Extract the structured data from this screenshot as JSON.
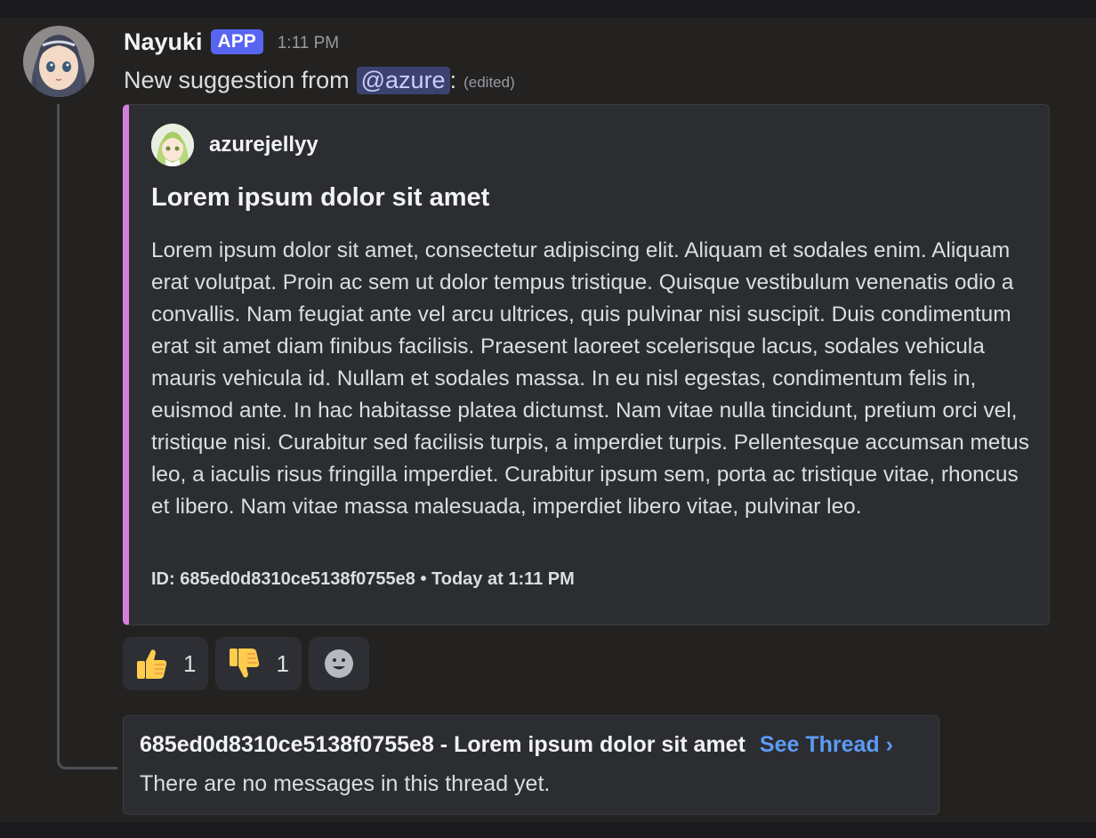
{
  "message": {
    "author": "Nayuki",
    "badge": "APP",
    "timestamp": "1:11 PM",
    "text_prefix": "New suggestion from",
    "mention": "@azure",
    "text_suffix": ":",
    "edited": "(edited)"
  },
  "embed": {
    "accent_color": "#d77de0",
    "author_name": "azurejellyy",
    "title": "Lorem ipsum dolor sit amet",
    "description": "Lorem ipsum dolor sit amet, consectetur adipiscing elit. Aliquam et sodales enim. Aliquam erat volutpat. Proin ac sem ut dolor tempus tristique. Quisque vestibulum venenatis odio a convallis. Nam feugiat ante vel arcu ultrices, quis pulvinar nisi suscipit. Duis condimentum erat sit amet diam finibus facilisis. Praesent laoreet scelerisque lacus, sodales vehicula mauris vehicula id. Nullam et sodales massa. In eu nisl egestas, condimentum felis in, euismod ante. In hac habitasse platea dictumst. Nam vitae nulla tincidunt, pretium orci vel, tristique nisi. Curabitur sed facilisis turpis, a imperdiet turpis. Pellentesque accumsan metus leo, a iaculis risus fringilla imperdiet. Curabitur ipsum sem, porta ac tristique vitae, rhoncus et libero. Nam vitae massa malesuada, imperdiet libero vitae, pulvinar leo.",
    "footer": "ID: 685ed0d8310ce5138f0755e8 • Today at 1:11 PM"
  },
  "reactions": [
    {
      "icon": "thumbs-up-icon",
      "count": "1"
    },
    {
      "icon": "thumbs-down-icon",
      "count": "1"
    }
  ],
  "add_reaction_icon": "smiley-icon",
  "thread": {
    "title": "685ed0d8310ce5138f0755e8 - Lorem ipsum dolor sit amet",
    "see_thread": "See Thread ›",
    "empty_text": "There are no messages in this thread yet."
  }
}
